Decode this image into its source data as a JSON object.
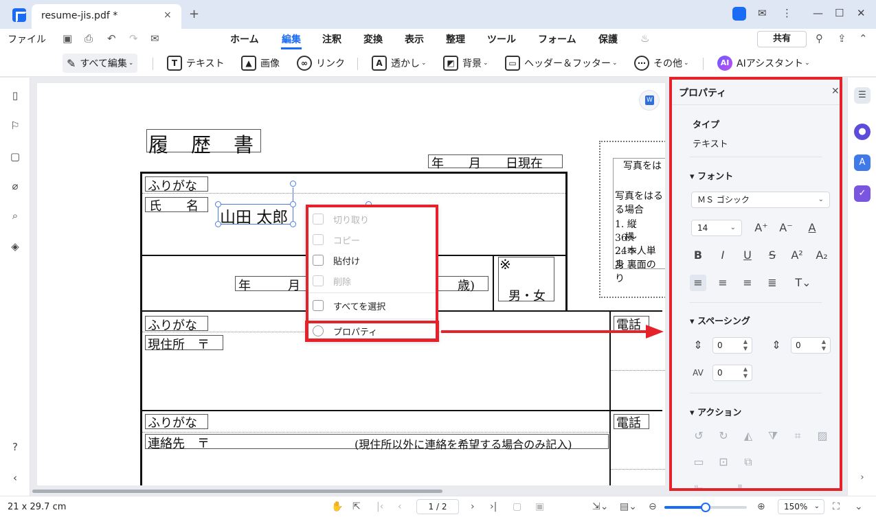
{
  "titlebar": {
    "tab_title": "resume-jis.pdf *",
    "tab_close": "×",
    "new_tab": "+"
  },
  "menubar": {
    "file": "ファイル",
    "items": [
      "ホーム",
      "編集",
      "注釈",
      "変換",
      "表示",
      "整理",
      "ツール",
      "フォーム",
      "保護"
    ],
    "active": "編集",
    "share": "共有"
  },
  "toolbar": {
    "edit_all": "すべて編集",
    "text": "テキスト",
    "image": "画像",
    "link": "リンク",
    "watermark": "透かし",
    "background": "背景",
    "header_footer": "ヘッダー＆フッター",
    "more": "その他",
    "ai": "AIアシスタント",
    "ai_badge": "AI"
  },
  "document": {
    "title": "履　歴　書",
    "date_line": "年　　月　　日現在",
    "furigana": "ふりがな",
    "name_label": "氏　　名",
    "name_value": "山田 太郎",
    "birth_line": "年　　　月",
    "age_suffix": "歳)",
    "note_mark": "※",
    "gender": "男・女",
    "address_label": "現住所　〒",
    "phone": "電話",
    "contact_label": "連絡先　〒",
    "contact_note": "(現住所以外に連絡を希望する場合のみ記入)",
    "photo_lines": [
      "写真をは",
      "写真をはる",
      "る場合",
      "1. 縦　36〜",
      "　横　24〜",
      "2. 本人単身",
      "3. 裏面のり"
    ]
  },
  "context_menu": {
    "items": [
      {
        "label": "切り取り",
        "enabled": false
      },
      {
        "label": "コピー",
        "enabled": false
      },
      {
        "label": "貼付け",
        "enabled": true
      },
      {
        "label": "削除",
        "enabled": false
      },
      {
        "label": "すべてを選択",
        "enabled": true
      },
      {
        "label": "プロパティ",
        "enabled": true
      }
    ]
  },
  "properties": {
    "title": "プロパティ",
    "type_label": "タイプ",
    "type_value": "テキスト",
    "font_label": "フォント",
    "font_name": "ＭＳ ゴシック",
    "font_size": "14",
    "spacing_label": "スペーシング",
    "line_spacing": "0",
    "para_spacing": "0",
    "char_spacing": "0",
    "action_label": "アクション"
  },
  "statusbar": {
    "page_size": "21 x 29.7 cm",
    "current_page": "1",
    "total_pages": "2",
    "zoom": "150%",
    "zoom_level": 0.5
  },
  "colors": {
    "accent": "#1a6cf5",
    "highlight": "#e5222a"
  }
}
